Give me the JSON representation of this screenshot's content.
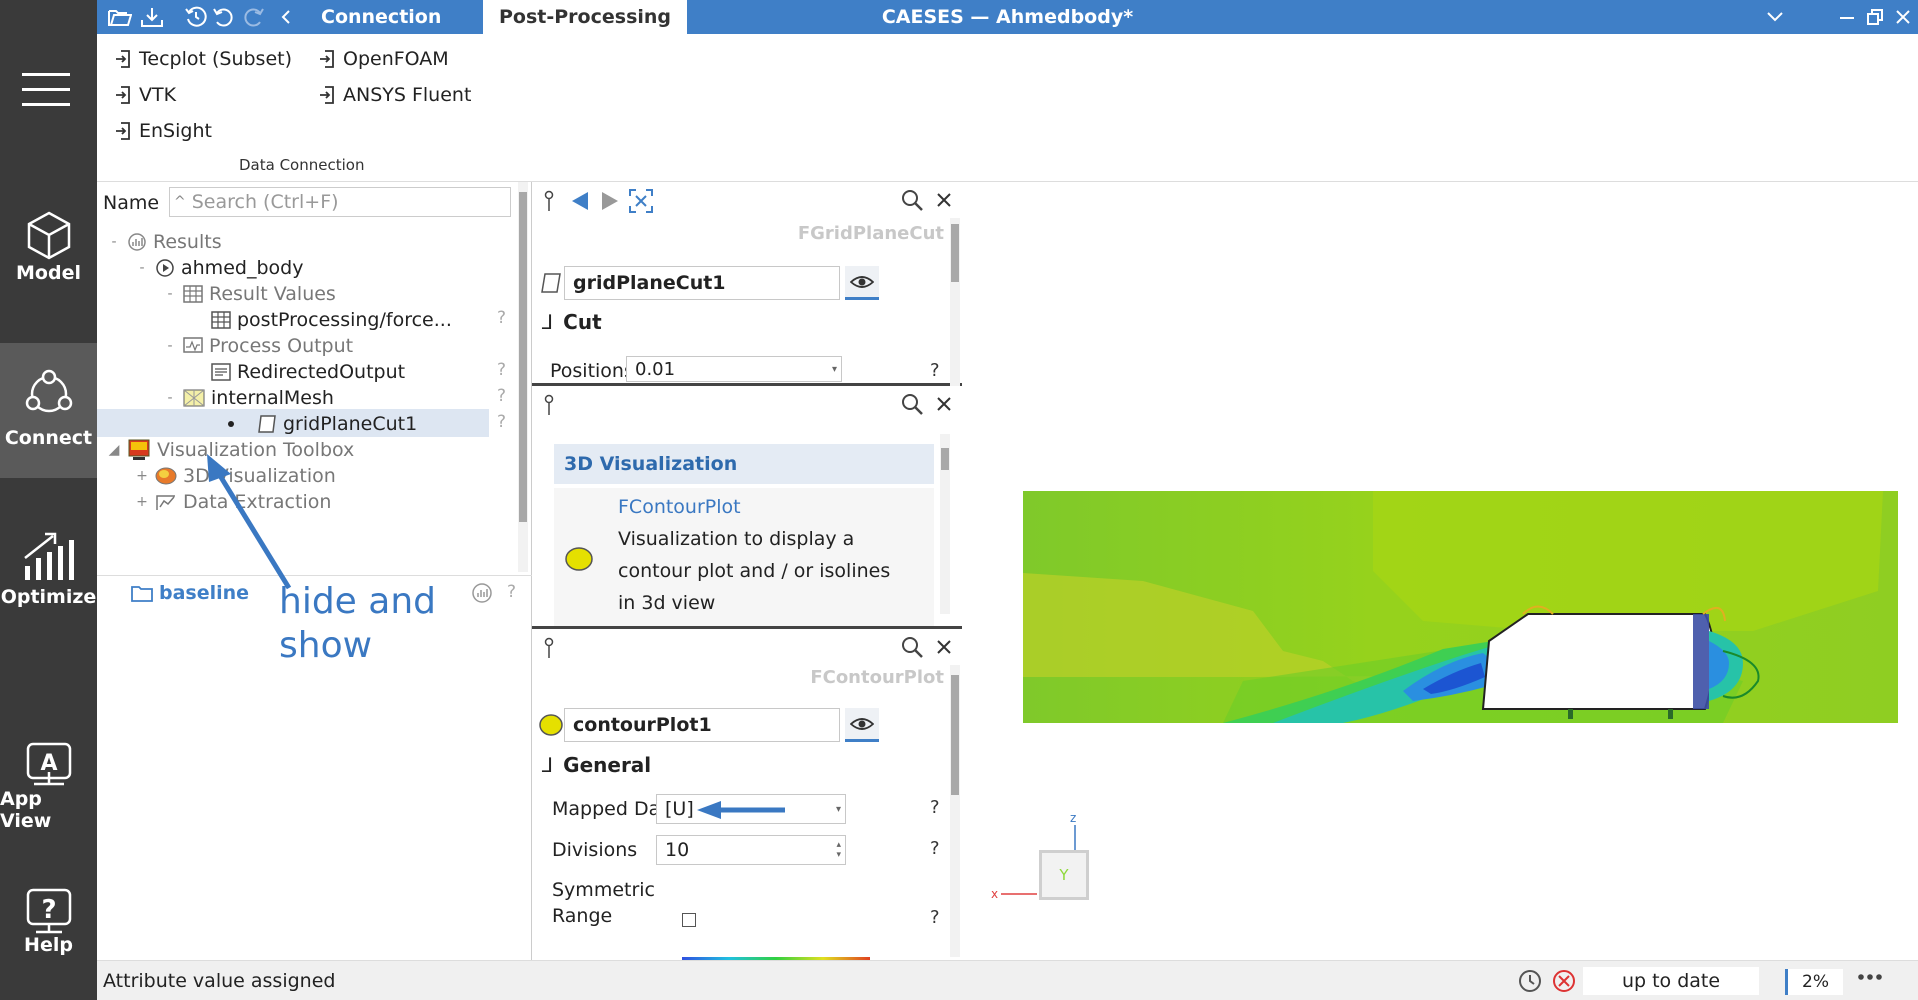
{
  "app": {
    "title": "CAESES — Ahmedbody*"
  },
  "titlebar_tabs": [
    {
      "label": "Connection"
    },
    {
      "label": "Post-Processing"
    }
  ],
  "left_nav": [
    {
      "label": "Model",
      "icon": "cube-icon"
    },
    {
      "label": "Connect",
      "icon": "connect-icon"
    },
    {
      "label": "Optimize",
      "icon": "chart-icon"
    },
    {
      "label": "App View",
      "icon": "app-view-icon"
    },
    {
      "label": "Help",
      "icon": "help-icon"
    }
  ],
  "ribbon": {
    "items": [
      "Tecplot (Subset)",
      "VTK",
      "EnSight",
      "OpenFOAM",
      "ANSYS Fluent"
    ],
    "group_label": "Data Connection"
  },
  "tree": {
    "name_label": "Name",
    "search_placeholder": "Search (Ctrl+F)",
    "items": [
      {
        "label": "Results"
      },
      {
        "label": "ahmed_body"
      },
      {
        "label": "Result Values"
      },
      {
        "label": "postProcessing/force..."
      },
      {
        "label": "Process Output"
      },
      {
        "label": "RedirectedOutput"
      },
      {
        "label": "internalMesh"
      },
      {
        "label": "gridPlaneCut1"
      },
      {
        "label": "Visualization Toolbox"
      },
      {
        "label": "3D Visualization"
      },
      {
        "label": "Data Extraction"
      }
    ],
    "baseline": "baseline",
    "annotation": [
      "hide and",
      "show"
    ],
    "help_mark": "?"
  },
  "panel1": {
    "type_label": "FGridPlaneCut",
    "name_value": "gridPlaneCut1",
    "section": "Cut",
    "positions_label": "Positions",
    "positions_value": "0.01"
  },
  "panel2": {
    "header": "3D Visualization",
    "item_title": "FContourPlot",
    "item_desc_1": "Visualization to display a",
    "item_desc_2": "contour plot and / or isolines",
    "item_desc_3": "in 3d view"
  },
  "panel3": {
    "type_label": "FContourPlot",
    "name_value": "contourPlot1",
    "section": "General",
    "mapped_label": "Mapped Data",
    "mapped_value": "[U]",
    "divisions_label": "Divisions",
    "divisions_value": "10",
    "symmetric_label_1": "Symmetric",
    "symmetric_label_2": "Range"
  },
  "viewport": {
    "axis_z": "z",
    "axis_x": "x",
    "cube_face": "Y"
  },
  "status": {
    "message": "Attribute value assigned",
    "state": "up to date",
    "percent": "2%"
  },
  "colors": {
    "accent": "#3f7fc7",
    "nav_bg": "#3a3a3a",
    "annotation": "#3a78c2"
  }
}
